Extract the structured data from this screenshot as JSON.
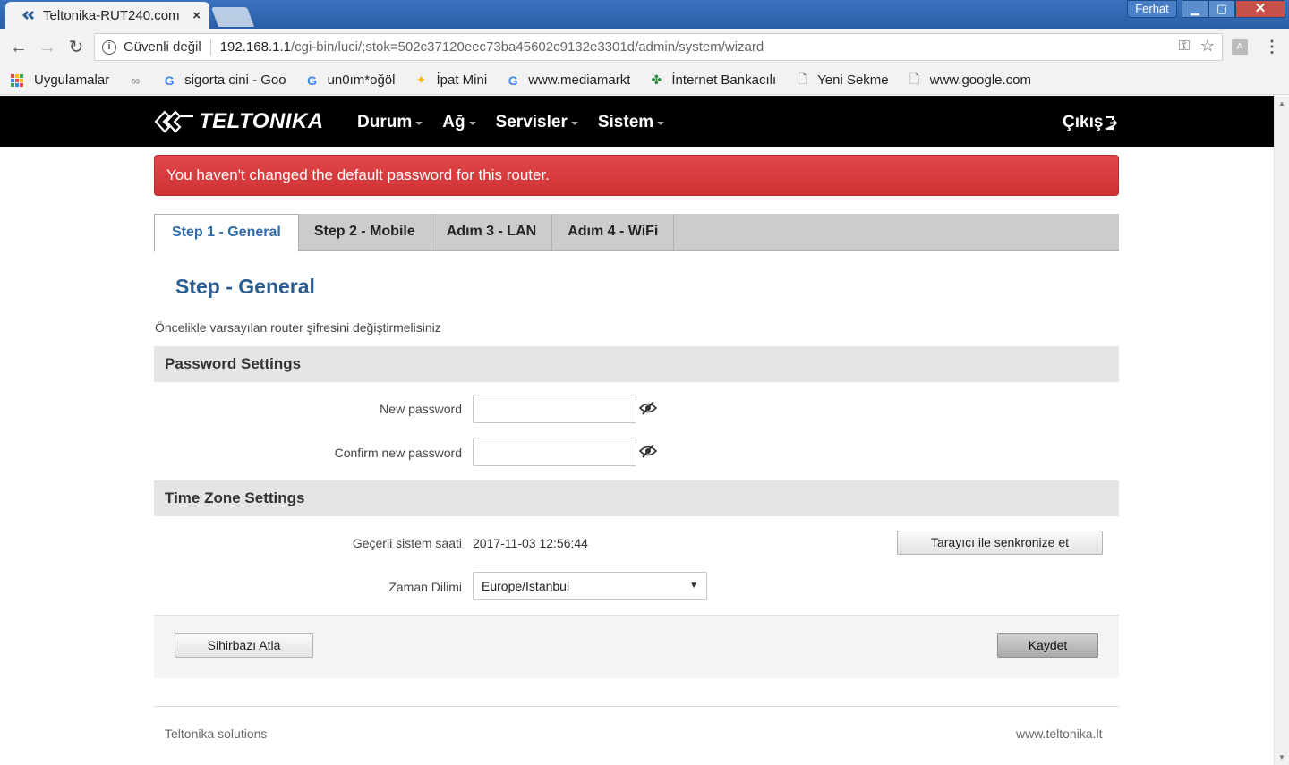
{
  "browser": {
    "tab_title": "Teltonika-RUT240.com",
    "tab_close": "×",
    "profile_name": "Ferhat",
    "window_min": "▁",
    "window_max": "▢",
    "window_close": "✕",
    "security_label": "Güvenli değil",
    "url_host": "192.168.1.1",
    "url_path": "/cgi-bin/luci/;stok=502c37120eec73ba45602c9132e3301d/admin/system/wizard"
  },
  "bookmarks": [
    {
      "icon": "apps-icon",
      "label": "Uygulamalar"
    },
    {
      "icon": "incognito-icon",
      "label": ""
    },
    {
      "icon": "google-icon",
      "label": "sigorta cini - Goo"
    },
    {
      "icon": "google-icon",
      "label": "un0ım*oğöl"
    },
    {
      "icon": "pinwheel-icon",
      "label": "İpat Mini"
    },
    {
      "icon": "google-icon",
      "label": "www.mediamarkt"
    },
    {
      "icon": "clover-icon",
      "label": "İnternet Bankacılı"
    },
    {
      "icon": "page-icon",
      "label": "Yeni Sekme"
    },
    {
      "icon": "page-icon",
      "label": "www.google.com"
    }
  ],
  "nav": {
    "logo": "TELTONIKA",
    "items": [
      "Durum",
      "Ağ",
      "Servisler",
      "Sistem"
    ],
    "logout": "Çıkış"
  },
  "alert": "You haven't changed the default password for this router.",
  "steps": [
    "Step 1 - General",
    "Step 2 - Mobile",
    "Adım 3 - LAN",
    "Adım 4 - WiFi"
  ],
  "main": {
    "title": "Step - General",
    "intro": "Öncelikle varsayılan router şifresini değiştirmelisiniz",
    "password_section": "Password Settings",
    "new_password_label": "New password",
    "confirm_password_label": "Confirm new password",
    "new_password_value": "",
    "confirm_password_value": "",
    "timezone_section": "Time Zone Settings",
    "current_time_label": "Geçerli sistem saati",
    "current_time_value": "2017-11-03 12:56:44",
    "sync_button": "Tarayıcı ile senkronize et",
    "timezone_label": "Zaman Dilimi",
    "timezone_value": "Europe/Istanbul",
    "skip_button": "Sihirbazı Atla",
    "save_button": "Kaydet"
  },
  "footer": {
    "left": "Teltonika solutions",
    "right": "www.teltonika.lt"
  },
  "colors": {
    "alert_red": "#d9383a",
    "brand_blue": "#2a5d91",
    "nav_black": "#000000"
  }
}
